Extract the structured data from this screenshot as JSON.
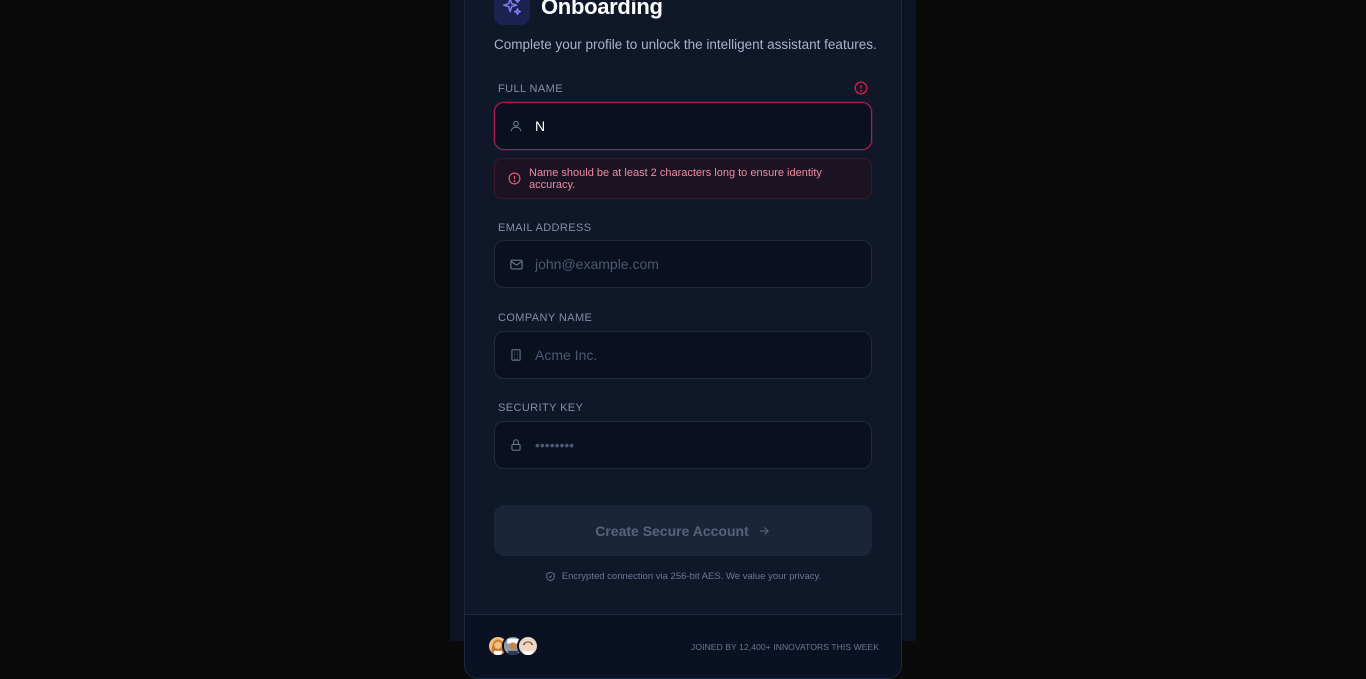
{
  "header": {
    "title": "Onboarding",
    "subtitle": "Complete your profile to unlock the intelligent assistant features.",
    "logo_icon": "sparkles-icon"
  },
  "form": {
    "full_name": {
      "label": "FULL NAME",
      "value": "N",
      "placeholder": "",
      "icon": "user-icon",
      "error": "Name should be at least 2 characters long to ensure identity accuracy."
    },
    "email": {
      "label": "EMAIL ADDRESS",
      "value": "",
      "placeholder": "john@example.com",
      "icon": "mail-icon"
    },
    "company": {
      "label": "COMPANY NAME",
      "value": "",
      "placeholder": "Acme Inc.",
      "icon": "building-icon"
    },
    "security_key": {
      "label": "SECURITY KEY",
      "value": "",
      "placeholder": "••••••••",
      "icon": "lock-icon"
    },
    "submit_label": "Create Secure Account"
  },
  "security_note": "Encrypted connection via 256-bit AES. We value your privacy.",
  "footer": {
    "joined_text": "JOINED BY 12,400+ INNOVATORS THIS WEEK"
  },
  "colors": {
    "accent": "#6366f1",
    "error": "#e11d48",
    "background": "#0f1729"
  }
}
